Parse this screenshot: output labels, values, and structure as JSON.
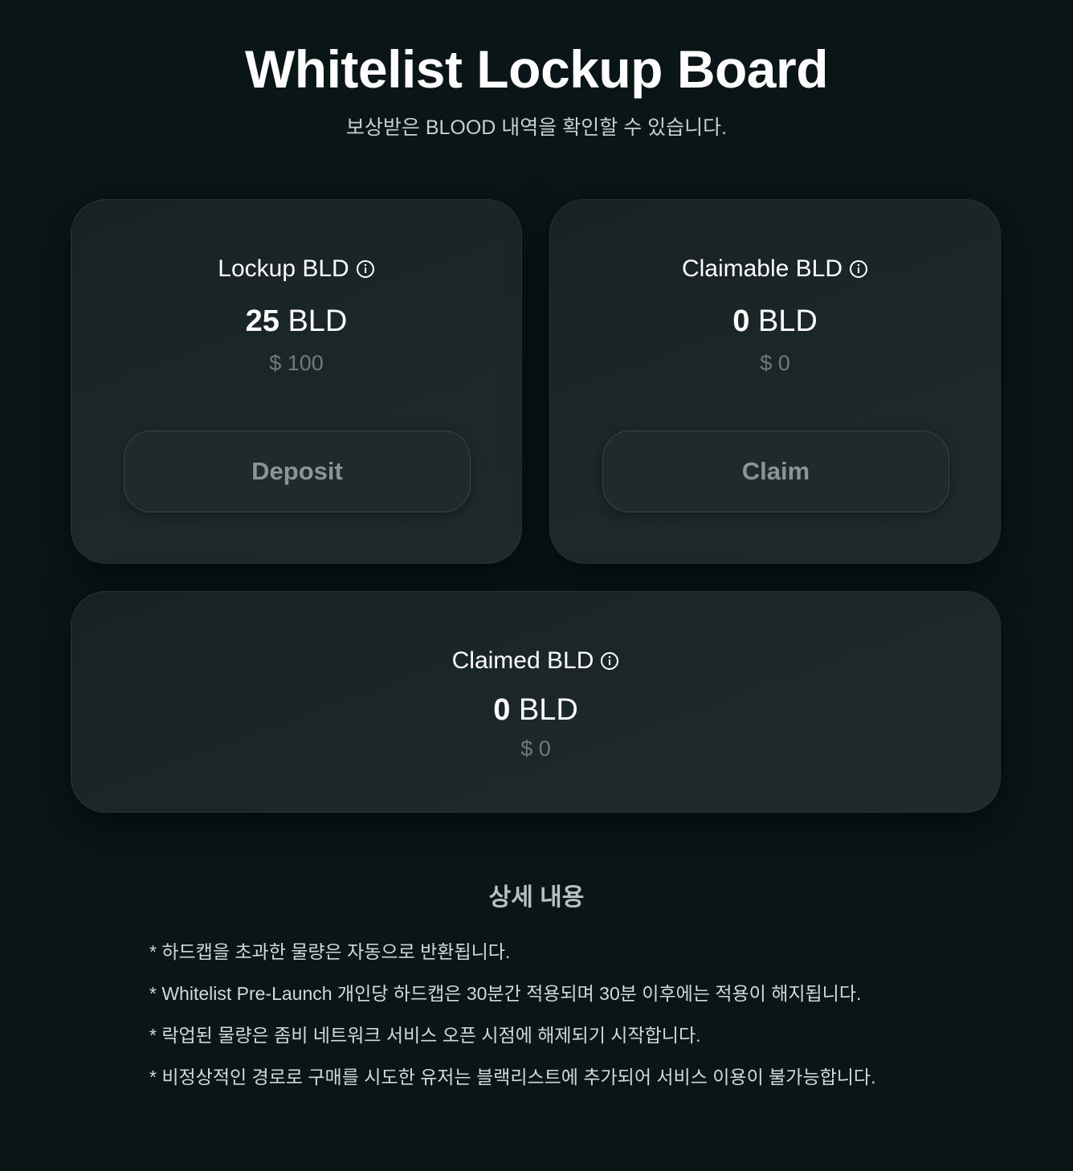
{
  "header": {
    "title": "Whitelist Lockup Board",
    "subtitle": "보상받은 BLOOD 내역을 확인할 수 있습니다."
  },
  "cards": {
    "lockup": {
      "label": "Lockup BLD",
      "amount": "25",
      "unit": "BLD",
      "usd": "$ 100",
      "button_label": "Deposit"
    },
    "claimable": {
      "label": "Claimable BLD",
      "amount": "0",
      "unit": "BLD",
      "usd": "$ 0",
      "button_label": "Claim"
    },
    "claimed": {
      "label": "Claimed BLD",
      "amount": "0",
      "unit": "BLD",
      "usd": "$ 0"
    }
  },
  "icons": {
    "info": "info-icon"
  },
  "details": {
    "title": "상세 내용",
    "items": [
      "* 하드캡을 초과한 물량은 자동으로 반환됩니다.",
      "* Whitelist Pre-Launch 개인당 하드캡은 30분간 적용되며 30분 이후에는 적용이 해지됩니다.",
      "* 락업된 물량은 좀비 네트워크 서비스 오픈 시점에 해제되기 시작합니다.",
      "* 비정상적인 경로로 구매를 시도한 유저는 블랙리스트에 추가되어 서비스 이용이 불가능합니다."
    ]
  },
  "colors": {
    "background": "#0a1518",
    "card": "#1c2729",
    "muted_text": "#6f7a7d",
    "button_text": "#8b9496"
  }
}
